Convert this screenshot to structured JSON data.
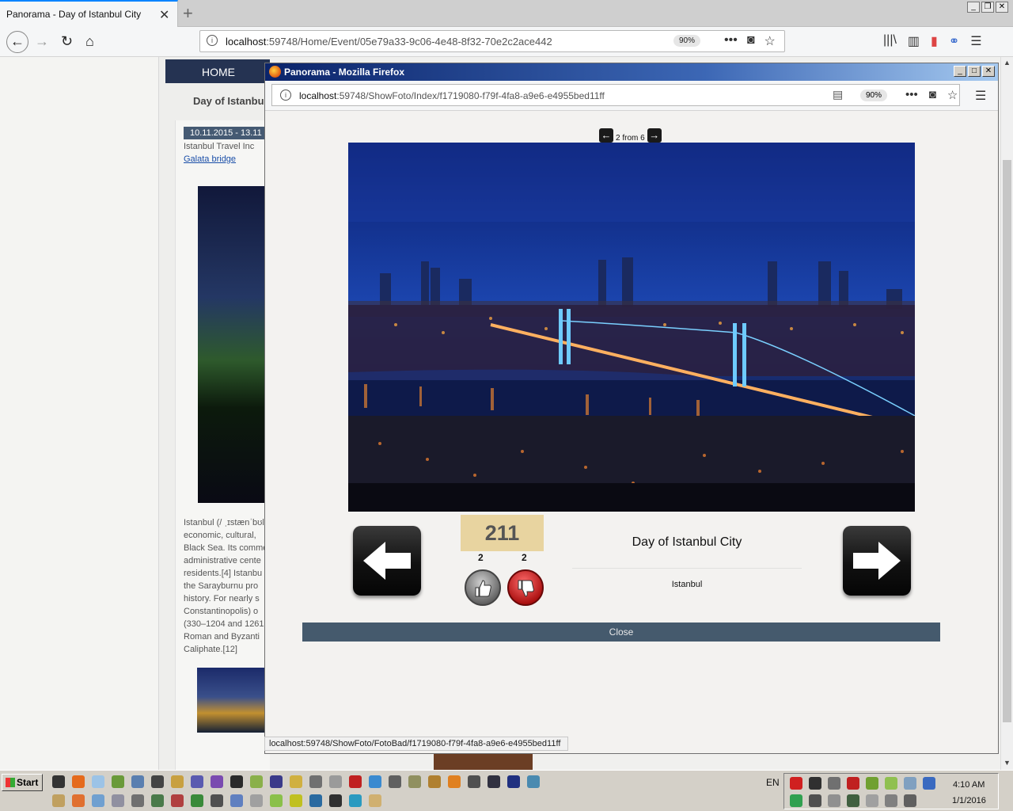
{
  "browser": {
    "tab_title": "Panorama - Day of Istanbul City",
    "url_host": "localhost",
    "url_rest": ":59748/Home/Event/05e79a33-9c06-4e48-8f32-70e2c2ace442",
    "zoom": "90%"
  },
  "page": {
    "nav_home": "HOME",
    "heading": "Day of Istanbul City",
    "date_range": "10.11.2015 - 13.11",
    "organizer": "Istanbul Travel Inc",
    "place_link": "Galata bridge",
    "description_lines": [
      "Istanbul (/ ˌɪstænˈbʊl/",
      "economic, cultural,",
      "Black Sea. Its comme",
      "administrative cente",
      "residents.[4] Istanbu",
      "the Sarayburnu pro",
      "history. For nearly s",
      "Constantinopolis) o",
      "(330–1204 and 1261",
      "Roman and Byzanti",
      "Caliphate.[12]"
    ]
  },
  "popup": {
    "window_title": "Panorama - Mozilla Firefox",
    "url_host": "localhost",
    "url_rest": ":59748/ShowFoto/Index/f1719080-f79f-4fa8-a9e6-e4955bed11ff",
    "zoom": "90%",
    "pager_current": "2",
    "pager_text": " from 6",
    "rating": "211",
    "likes": "2",
    "dislikes": "2",
    "photo_title": "Day of Istanbul City",
    "photo_location": "Istanbul",
    "close_label": "Close"
  },
  "status_url": "localhost:59748/ShowFoto/FotoBad/f1719080-f79f-4fa8-a9e6-e4955bed11ff",
  "taskbar": {
    "start_label": "Start",
    "language": "EN",
    "time": "4:10 AM",
    "date": "1/1/2016"
  },
  "colors": {
    "accent_tab": "#0a84ff",
    "page_nav": "#253352",
    "close_button": "#455a6d",
    "rating_box": "#e8d4a0"
  }
}
